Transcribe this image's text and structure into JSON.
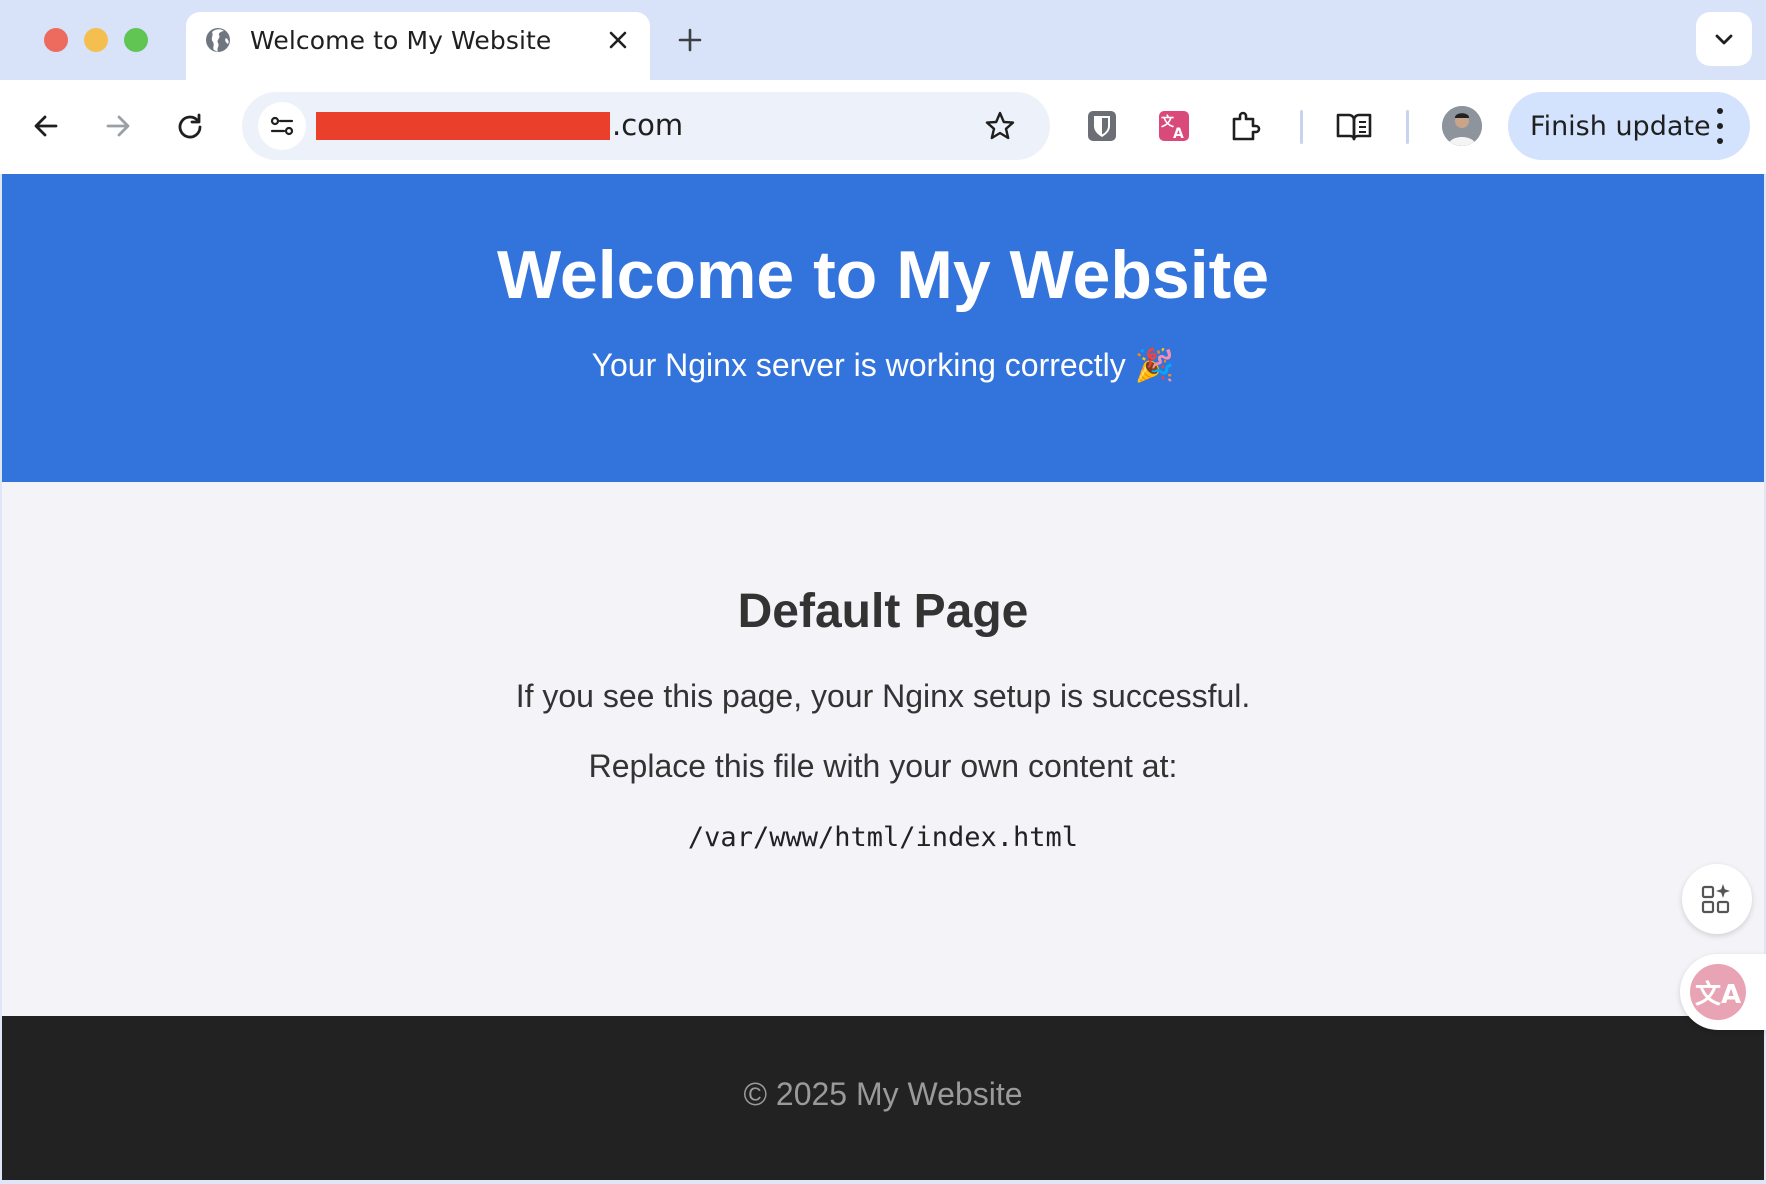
{
  "browser": {
    "tab": {
      "title": "Welcome to My Website",
      "favicon": "globe-icon"
    },
    "address_bar": {
      "url_visible_suffix": ".com",
      "redaction_color": "#ea3f2a"
    },
    "finish_update_label": "Finish update",
    "icons": {
      "back": "arrow-left-icon",
      "forward": "arrow-right-icon",
      "reload": "reload-icon",
      "site_info": "tune-icon",
      "bookmark": "star-icon",
      "ext_bitwarden": "shield-icon",
      "ext_translate": "translate-icon",
      "extensions": "puzzle-icon",
      "reading_mode": "book-icon",
      "menu": "kebab-icon"
    },
    "translate_badge": "文A"
  },
  "page": {
    "hero": {
      "title": "Welcome to My Website",
      "subtitle": "Your Nginx server is working correctly 🎉",
      "background": "#3273dc"
    },
    "main": {
      "heading": "Default Page",
      "paragraph_1": "If you see this page, your Nginx setup is successful.",
      "paragraph_2": "Replace this file with your own content at:",
      "path": "/var/www/html/index.html"
    },
    "footer": {
      "text": "© 2025 My Website",
      "background": "#222222"
    }
  }
}
